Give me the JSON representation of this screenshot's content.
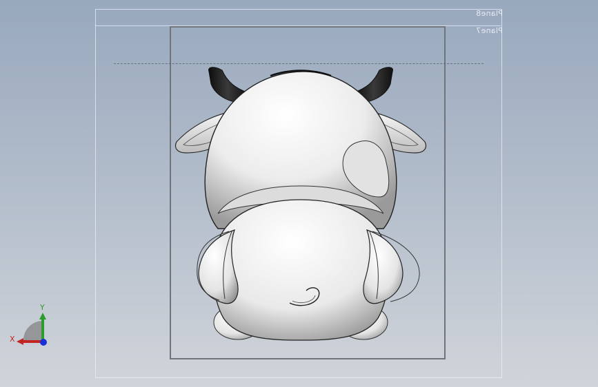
{
  "viewport": {
    "planes": [
      {
        "label": "Plane8"
      },
      {
        "label": "Plane7"
      }
    ],
    "triad": {
      "x_label": "X",
      "y_label": "Y"
    },
    "colors": {
      "background_top": "#98a8bd",
      "background_bottom": "#d1d4da",
      "horns": "#1f1f1f",
      "body": "#f2f2f2",
      "x_axis": "#c22424",
      "y_axis": "#2c9c2c",
      "z_axis": "#1c2fd6"
    }
  }
}
